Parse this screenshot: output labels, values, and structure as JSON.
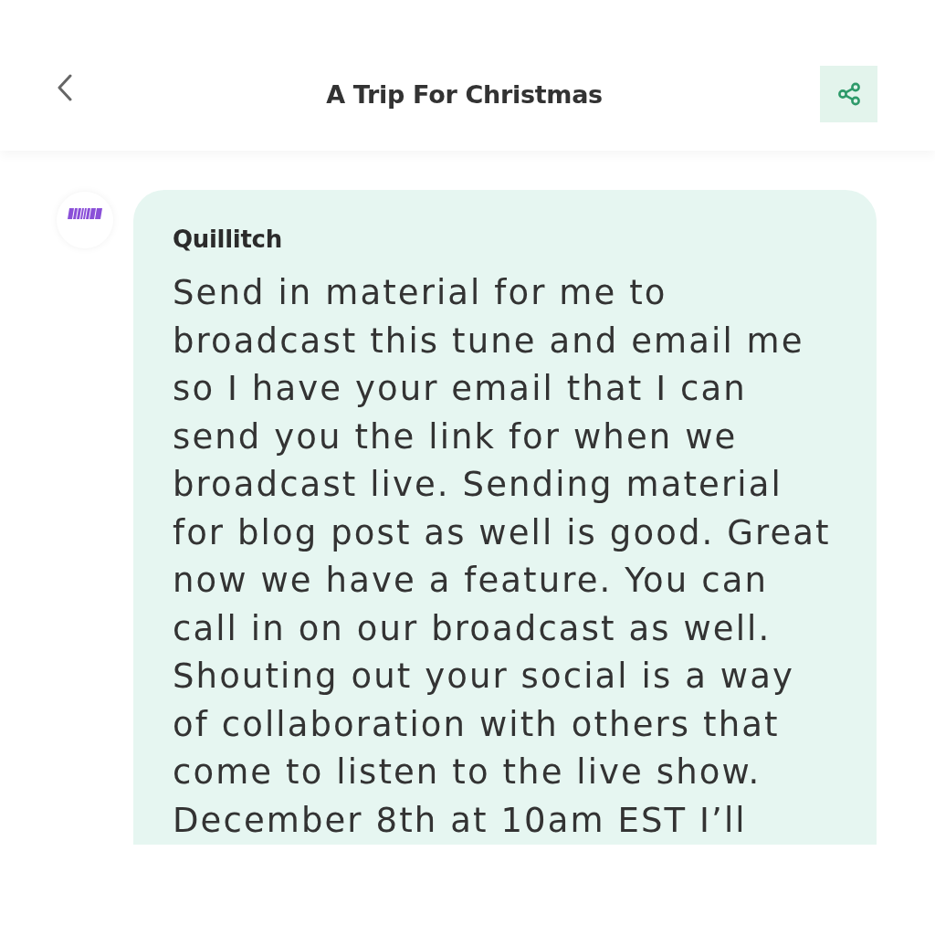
{
  "header": {
    "title": "A Trip For Christmas"
  },
  "messages": [
    {
      "sender": "Quillitch",
      "text": "Send in material for me to broadcast this tune and email me so I have your email that I can send you the link for when we broadcast live. Sending material for blog post as well is good. Great now we have a feature. You can call in on our broadcast as well. Shouting out your social is a way of collaboration with others that come to listen to the live show. December 8th at 10am EST I’ll"
    }
  ]
}
